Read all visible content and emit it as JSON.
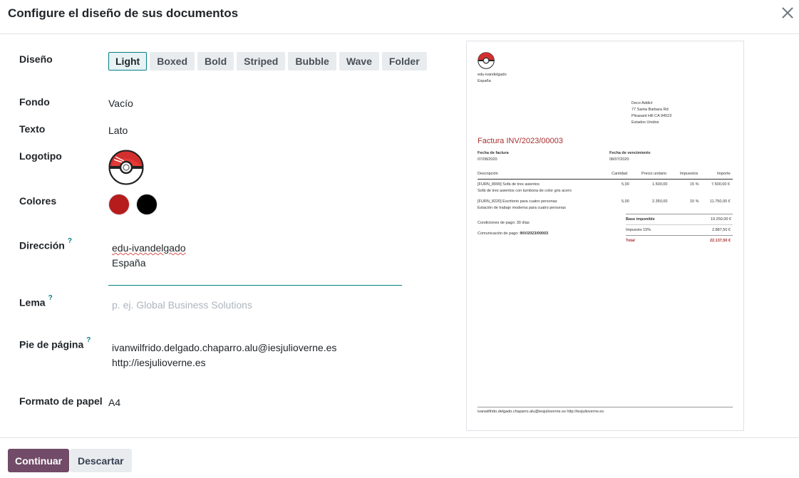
{
  "dialog": {
    "title": "Configure el diseño de sus documentos"
  },
  "fields": {
    "layout_label": "Diseño",
    "background_label": "Fondo",
    "background_value": "Vacío",
    "font_label": "Texto",
    "font_value": "Lato",
    "logo_label": "Logotipo",
    "colors_label": "Colores",
    "address_label": "Dirección",
    "address_lines": [
      "edu-ivandelgado",
      "España"
    ],
    "tagline_label": "Lema",
    "tagline_placeholder": "p. ej. Global Business Solutions",
    "footer_label": "Pie de página",
    "footer_lines": [
      "ivanwilfrido.delgado.chaparro.alu@iesjulioverne.es",
      "http://iesjulioverne.es"
    ],
    "paper_label": "Formato de papel",
    "paper_value": "A4",
    "help_mark": "?"
  },
  "layouts": [
    "Light",
    "Boxed",
    "Bold",
    "Striped",
    "Bubble",
    "Wave",
    "Folder"
  ],
  "selected_layout": "Light",
  "colors": {
    "primary": "#b71c1c",
    "secondary": "#000000",
    "accent": "#017e84",
    "brand": "#714b67"
  },
  "preview": {
    "company_name": "edu-ivandelgado",
    "company_country": "España",
    "customer": [
      "Deco Addict",
      "77 Santa Barbara Rd",
      "Pleasant Hill CA 94523",
      "Estados Unidos"
    ],
    "invoice_title": "Factura INV/2023/00003",
    "invoice_date_label": "Fecha de factura",
    "invoice_date": "07/08/2020",
    "due_date_label": "Fecha de vencimiento",
    "due_date": "08/07/2020",
    "columns": [
      "Descripción",
      "Cantidad",
      "Precio unitario",
      "Impuestos",
      "Importe"
    ],
    "lines": [
      {
        "desc": "[FURN_8999] Sofá de tres asientos",
        "sub": "Sofá de tres asientos con tumbona de color gris acero",
        "qty": "5,00",
        "price": "1.500,00",
        "tax": "15 %",
        "amount": "7.500,00 €"
      },
      {
        "desc": "[FURN_8220] Escritorio para cuatro personas",
        "sub": "Estación de trabajo moderna para cuatro personas",
        "qty": "5,00",
        "price": "2.350,00",
        "tax": "15 %",
        "amount": "11.750,00 €"
      }
    ],
    "payment_terms": "Condiciones de pago: 30 días",
    "payment_comm_label": "Comunicación de pago:",
    "payment_comm": "INV/2023/00003",
    "subtotal_label": "Base imponible",
    "subtotal": "19.250,00 €",
    "tax_label": "Impuesto 15%",
    "tax": "2.887,50 €",
    "total_label": "Total",
    "total": "22.137,50 €",
    "footer": "ivanwilfrido.delgado.chaparro.alu@iesjulioverne.es http://iesjulioverne.es"
  },
  "actions": {
    "continue": "Continuar",
    "discard": "Descartar"
  }
}
